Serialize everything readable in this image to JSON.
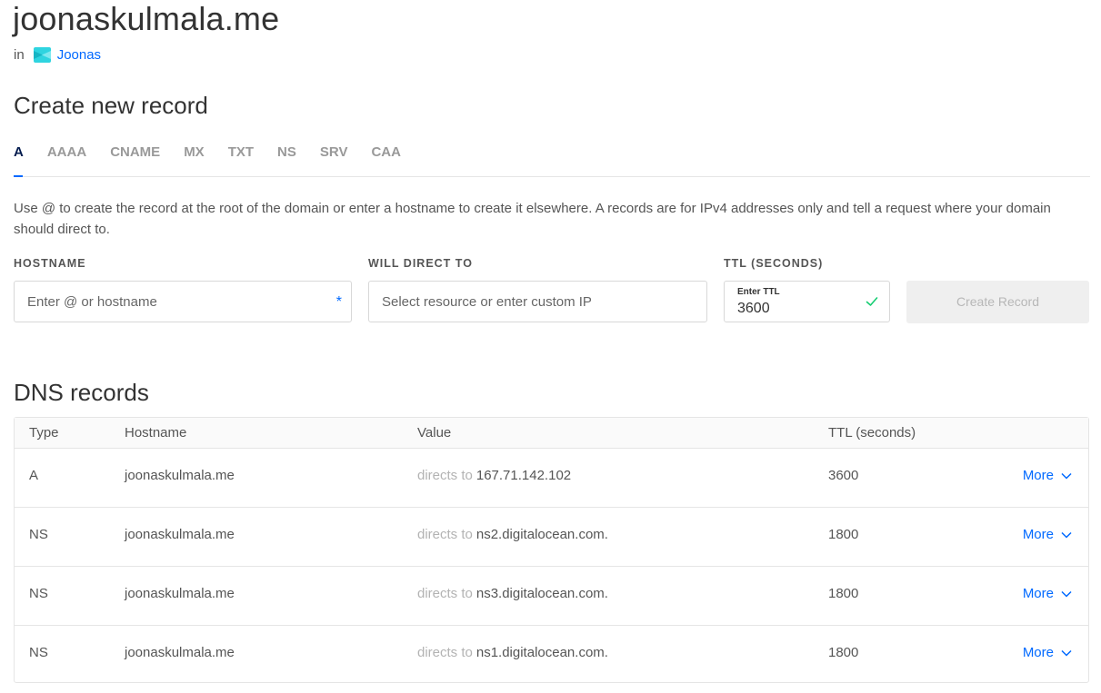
{
  "header": {
    "domain": "joonaskulmala.me",
    "in_text": "in",
    "project_name": "Joonas"
  },
  "create": {
    "title": "Create new record",
    "tabs": [
      "A",
      "AAAA",
      "CNAME",
      "MX",
      "TXT",
      "NS",
      "SRV",
      "CAA"
    ],
    "active_tab": "A",
    "help_text": "Use @ to create the record at the root of the domain or enter a hostname to create it elsewhere. A records are for IPv4 addresses only and tell a request where your domain should direct to.",
    "hostname_label": "HOSTNAME",
    "hostname_placeholder": "Enter @ or hostname",
    "hostname_required_mark": "*",
    "direct_label": "WILL DIRECT TO",
    "direct_placeholder": "Select resource or enter custom IP",
    "ttl_label": "TTL (SECONDS)",
    "ttl_inner_label": "Enter TTL",
    "ttl_value": "3600",
    "button_label": "Create Record"
  },
  "dns": {
    "title": "DNS records",
    "columns": [
      "Type",
      "Hostname",
      "Value",
      "TTL (seconds)"
    ],
    "directs_prefix": "directs to",
    "more_label": "More",
    "rows": [
      {
        "type": "A",
        "hostname": "joonaskulmala.me",
        "value": "167.71.142.102",
        "ttl": "3600"
      },
      {
        "type": "NS",
        "hostname": "joonaskulmala.me",
        "value": "ns2.digitalocean.com.",
        "ttl": "1800"
      },
      {
        "type": "NS",
        "hostname": "joonaskulmala.me",
        "value": "ns3.digitalocean.com.",
        "ttl": "1800"
      },
      {
        "type": "NS",
        "hostname": "joonaskulmala.me",
        "value": "ns1.digitalocean.com.",
        "ttl": "1800"
      }
    ]
  },
  "colors": {
    "accent": "#0069ff",
    "active_tab_text": "#031b4e",
    "success": "#15cd72"
  }
}
